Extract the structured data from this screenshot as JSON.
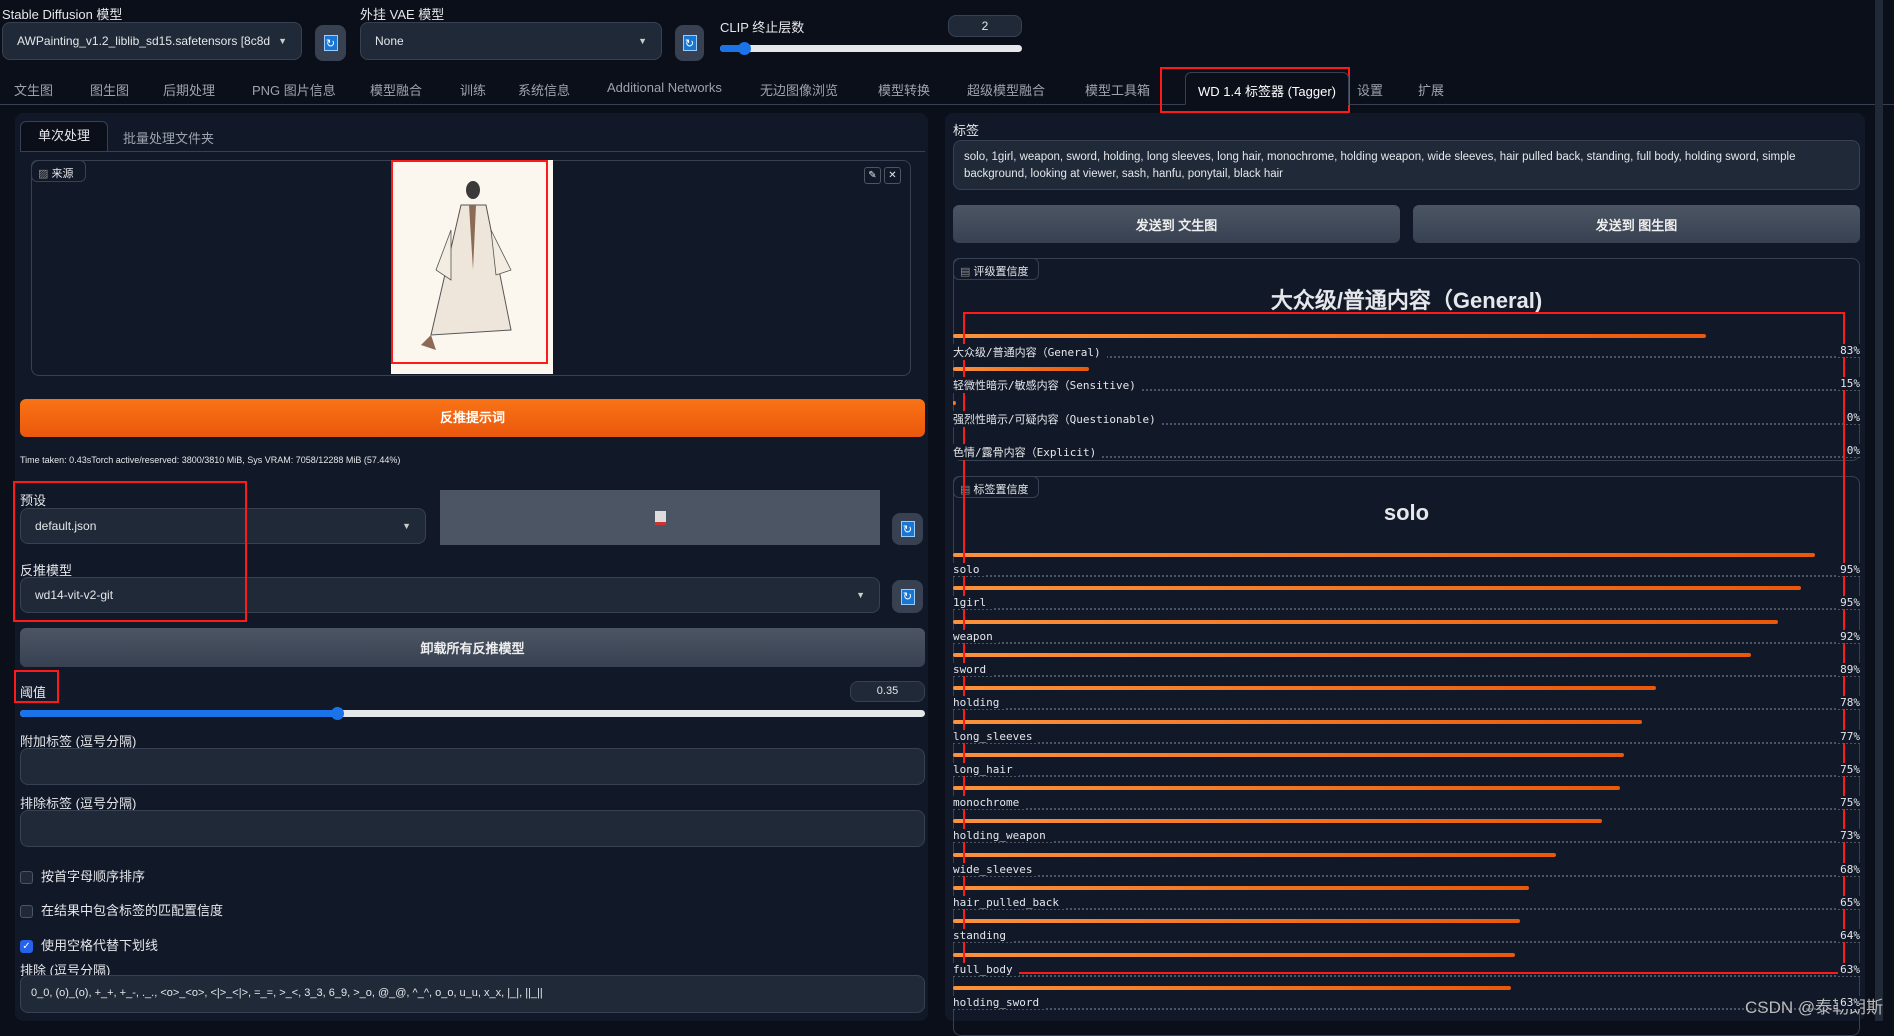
{
  "top": {
    "sd_label": "Stable Diffusion 模型",
    "sd_value": "AWPainting_v1.2_liblib_sd15.safetensors [8c8d",
    "vae_label": "外挂 VAE 模型",
    "vae_value": "None",
    "clip_label": "CLIP 终止层数",
    "clip_value": "2",
    "clip_fraction": 0.08
  },
  "tabs": [
    "文生图",
    "图生图",
    "后期处理",
    "PNG 图片信息",
    "模型融合",
    "训练",
    "系统信息",
    "Additional Networks",
    "无边图像浏览",
    "模型转换",
    "超级模型融合",
    "模型工具箱",
    "WD 1.4 标签器 (Tagger)",
    "设置",
    "扩展"
  ],
  "left": {
    "subtabs": [
      "单次处理",
      "批量处理文件夹"
    ],
    "source_label": "来源",
    "interrogate_button": "反推提示词",
    "time_text": "Time taken: 0.43sTorch active/reserved: 3800/3810 MiB, Sys VRAM: 7058/12288 MiB (57.44%)",
    "preset_label": "预设",
    "preset_value": "default.json",
    "model_label": "反推模型",
    "model_value": "wd14-vit-v2-git",
    "unload_button": "卸载所有反推模型",
    "threshold_label": "阈值",
    "threshold_value": "0.35",
    "threshold_fraction": 0.35,
    "additional_label": "附加标签 (逗号分隔)",
    "additional_value": "",
    "exclude_label": "排除标签 (逗号分隔)",
    "exclude_value": "",
    "checkboxes": [
      {
        "label": "按首字母顺序排序",
        "checked": false
      },
      {
        "label": "在结果中包含标签的匹配置信度",
        "checked": false
      },
      {
        "label": "使用空格代替下划线",
        "checked": true
      }
    ],
    "escape_label": "排除 (逗号分隔)",
    "escape_value": "0_0, (o)_(o), +_+, +_-, ._., <o>_<o>, <|>_<|>, =_=, >_<, 3_3, 6_9, >_o, @_@, ^_^, o_o, u_u, x_x, |_|, ||_||"
  },
  "right": {
    "tags_label": "标签",
    "tags_text": "solo, 1girl, weapon, sword, holding, long sleeves, long hair, monochrome, holding weapon, wide sleeves, hair pulled back, standing, full body, holding sword, simple background, looking at viewer, sash, hanfu, ponytail, black hair",
    "send_txt2img": "发送到 文生图",
    "send_img2img": "发送到 图生图",
    "rating_label": "评级置信度",
    "rating_title": "大众级/普通内容（General)",
    "ratings": [
      {
        "name": "大众级/普通内容（General)",
        "pct": "83%",
        "value": 83
      },
      {
        "name": "轻微性暗示/敏感内容（Sensitive)",
        "pct": "15%",
        "value": 15
      },
      {
        "name": "强烈性暗示/可疑内容（Questionable)",
        "pct": "0%",
        "value": 0.3
      },
      {
        "name": "色情/露骨内容（Explicit)",
        "pct": "0%",
        "value": 0
      }
    ],
    "tag_label": "标签置信度",
    "tag_title": "solo",
    "tags": [
      {
        "name": "solo",
        "pct": "95%",
        "value": 95
      },
      {
        "name": "1girl",
        "pct": "95%",
        "value": 93.5
      },
      {
        "name": "weapon",
        "pct": "92%",
        "value": 91
      },
      {
        "name": "sword",
        "pct": "89%",
        "value": 88
      },
      {
        "name": "holding",
        "pct": "78%",
        "value": 77.5
      },
      {
        "name": "long_sleeves",
        "pct": "77%",
        "value": 76
      },
      {
        "name": "long_hair",
        "pct": "75%",
        "value": 74
      },
      {
        "name": "monochrome",
        "pct": "75%",
        "value": 73.5
      },
      {
        "name": "holding_weapon",
        "pct": "73%",
        "value": 71.5
      },
      {
        "name": "wide_sleeves",
        "pct": "68%",
        "value": 66.5
      },
      {
        "name": "hair_pulled_back",
        "pct": "65%",
        "value": 63.5
      },
      {
        "name": "standing",
        "pct": "64%",
        "value": 62.5
      },
      {
        "name": "full_body",
        "pct": "63%",
        "value": 62
      },
      {
        "name": "holding_sword",
        "pct": "63%",
        "value": 61.5
      }
    ]
  },
  "watermark": "CSDN @泰勒朗斯"
}
